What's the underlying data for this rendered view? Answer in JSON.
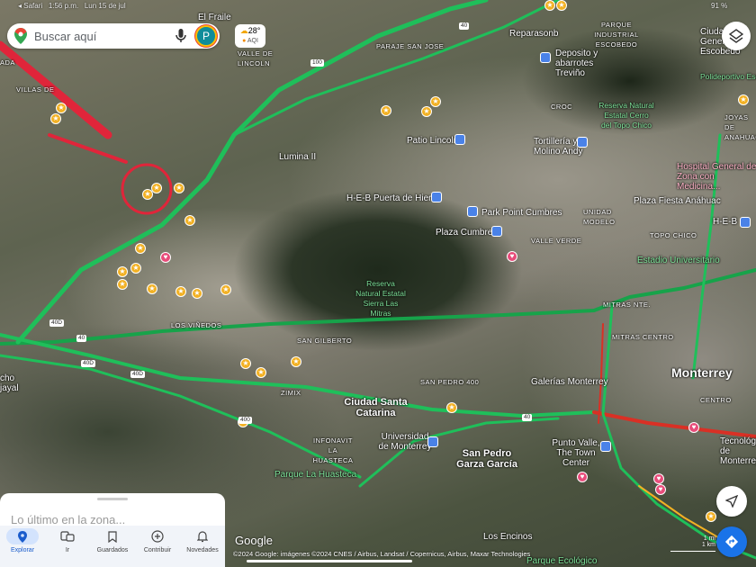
{
  "status_bar": {
    "app": "◂ Safari",
    "time": "1:56 p.m.",
    "date": "Lun 15 de jul",
    "battery": "91 %"
  },
  "search": {
    "placeholder": "Buscar aquí",
    "avatar_letter": "P"
  },
  "weather": {
    "temp": "28°",
    "aqi": "AQI"
  },
  "labels": [
    "El Fraile",
    "VALLE DE LINCOLN",
    "PARAJE SAN JOSE",
    "Reparasonb",
    "PARQUE INDUSTRIAL ESCOBEDO",
    "Ciudad General Escobedo",
    "Deposito y abarrotes Treviño",
    "CROC",
    "Reserva Natural Estatal Cerro del Topo Chico",
    "Polideportivo Escobedo",
    "JOYAS DE ANAHUAC",
    "Patio Lincoln",
    "Tortillería y Molino Andy",
    "Lumina II",
    "Hospital General de Zona con Medicina...",
    "H-E-B Puerta de Hierro",
    "Plaza Fiesta Anáhuac",
    "Park Point Cumbres",
    "UNIDAD MODELO",
    "H-E-B",
    "Plaza Cumbres",
    "VALLE VERDE",
    "TOPO CHICO",
    "Estadio Universitario",
    "Reserva Natural Estatal Sierra Las Mitras",
    "MITRAS NTE.",
    "LOS VIÑEDOS",
    "SAN GILBERTO",
    "MITRAS CENTRO",
    "Monterrey",
    "CENTRO",
    "SAN PEDRO 400",
    "Galerías Monterrey",
    "Ciudad Santa Catarina",
    "ZIMIX",
    "INFONAVIT LA HUASTECA",
    "Universidad de Monterrey",
    "San Pedro Garza García",
    "Punto Valle, The Town Center",
    "Parque La Huasteca",
    "Los Encinos",
    "Parque Ecológico",
    "Tecnológico de Monterrey",
    "cho jayal",
    "VILLAS DE",
    "ADA"
  ],
  "road_shields": [
    "100",
    "40",
    "40D",
    "40",
    "40D",
    "40D",
    "400",
    "40"
  ],
  "bottom_sheet": {
    "latest": "Lo último en la zona..."
  },
  "nav": [
    {
      "label": "Explorar",
      "icon": "pin-icon",
      "active": true
    },
    {
      "label": "Ir",
      "icon": "commute-icon"
    },
    {
      "label": "Guardados",
      "icon": "bookmark-icon"
    },
    {
      "label": "Contribuir",
      "icon": "add-circle-icon"
    },
    {
      "label": "Novedades",
      "icon": "bell-icon"
    }
  ],
  "map": {
    "logo": "Google",
    "attribution": "©2024 Google: imágenes ©2024 CNES / Airbus, Landsat / Copernicus, Airbus, Maxar Technologies",
    "scale_mi": "1 mi",
    "scale_km": "1 km"
  },
  "colors": {
    "traffic_green": "#1fbf5a",
    "traffic_red": "#d93025",
    "annotation_red": "#e0253a",
    "accent": "#1a73e8"
  }
}
